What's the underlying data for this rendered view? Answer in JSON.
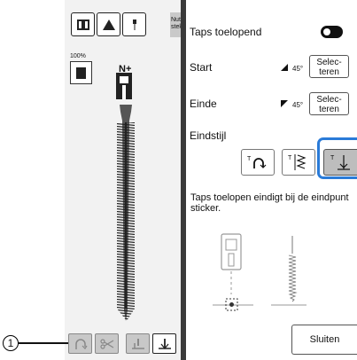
{
  "left_panel": {
    "nutti_label": "Nutti stek",
    "zoom": "100%",
    "needle_label": "N+"
  },
  "callout": {
    "number": "1"
  },
  "tapering": {
    "label": "Taps toelopend",
    "enabled": true,
    "start": {
      "label": "Start",
      "angle": "45°",
      "button": "Selec-\nteren"
    },
    "end": {
      "label": "Einde",
      "angle": "45°",
      "button": "Selec-\nteren"
    },
    "end_style": {
      "label": "Eindstijl",
      "selected_index": 2
    },
    "description": "Taps toelopen eindigt bij de eindpunt sticker.",
    "close_button": "Sluiten"
  },
  "colors": {
    "highlight": "#2a7bd8",
    "divider": "#3a3a3a"
  }
}
